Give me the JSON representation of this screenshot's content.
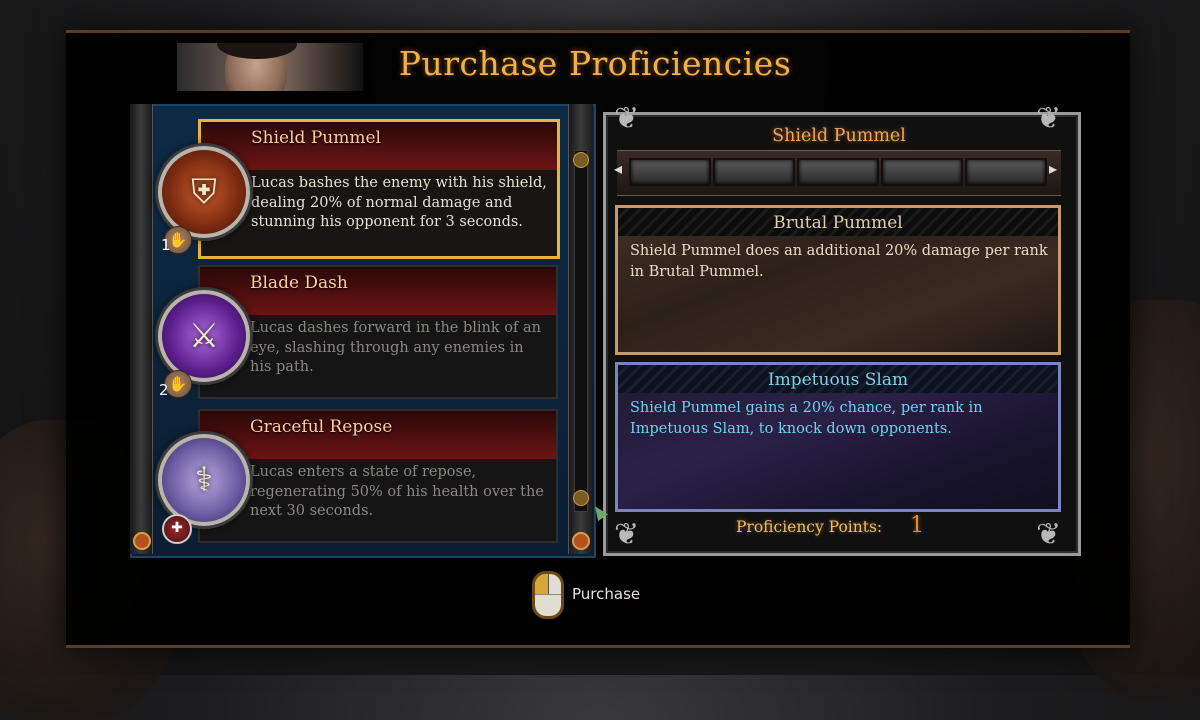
{
  "screen": {
    "title": "Purchase Proficiencies"
  },
  "proficiency_list": {
    "items": [
      {
        "title": "Shield Pummel",
        "description": "Lucas bashes the enemy with his shield, dealing 20% of normal damage and stunning his opponent for 3 seconds.",
        "rank_badge": "1",
        "selected": true,
        "icon": "shield-emblem-icon"
      },
      {
        "title": "Blade Dash",
        "description": "Lucas dashes forward in the blink of an eye, slashing through any enemies in his path.",
        "rank_badge": "2",
        "selected": false,
        "icon": "sword-slash-icon"
      },
      {
        "title": "Graceful Repose",
        "description": "Lucas enters a state of repose, regenerating 50% of his health over the next 30 seconds.",
        "rank_badge": "",
        "selected": false,
        "icon": "caduceus-shield-icon"
      }
    ]
  },
  "detail": {
    "title": "Shield Pummel",
    "rank_slots_total": 5,
    "rank_slots_filled": 0,
    "upgrades": [
      {
        "name": "Brutal Pummel",
        "description": "Shield Pummel does an additional 20% damage per rank in Brutal Pummel.",
        "accent": "#c79a6a"
      },
      {
        "name": "Impetuous Slam",
        "description": "Shield Pummel gains a 20% chance, per rank in Impetuous Slam, to knock down opponents.",
        "accent": "#7a84c0"
      }
    ],
    "points_label": "Proficiency Points:",
    "points_value": "1"
  },
  "controls": {
    "purchase_label": "Purchase",
    "purchase_icon": "mouse-left-click-icon"
  },
  "colors": {
    "title": "#f0b04a",
    "selected_border": "#e3b53a",
    "list_background": "#0d2a45"
  }
}
